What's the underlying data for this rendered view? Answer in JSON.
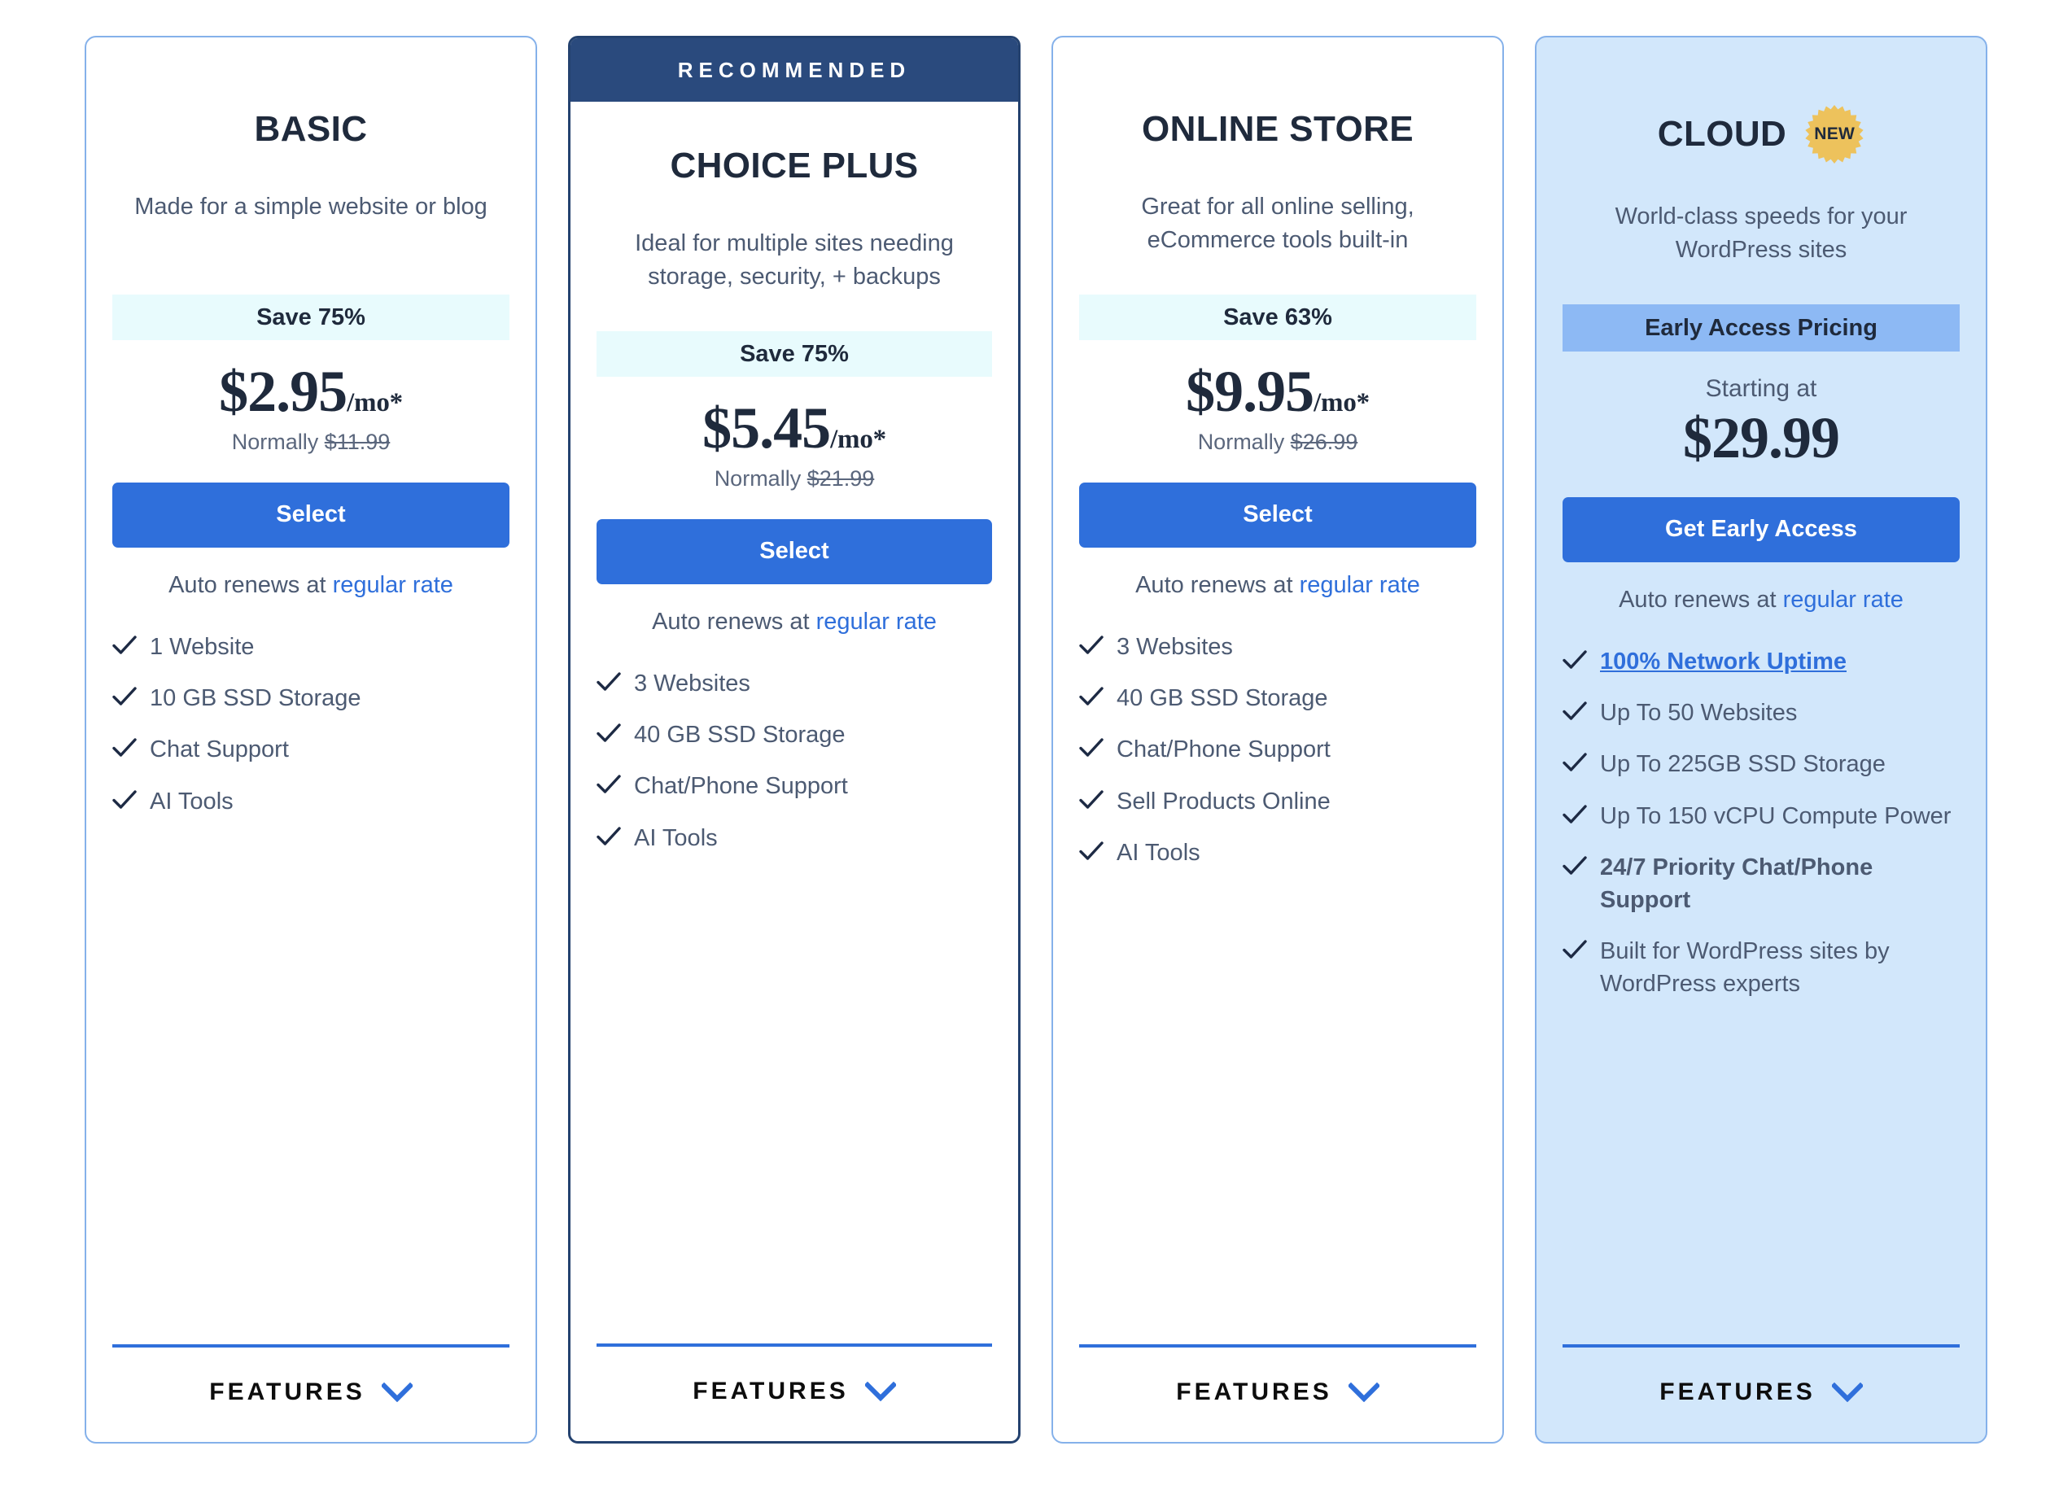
{
  "colors": {
    "accent_blue": "#2f6fdb",
    "navy": "#2a4a7d",
    "card_border": "#85b1ea",
    "save_banner_bg": "#e8fbfd",
    "cloud_card_bg": "#d2e7fb",
    "cloud_banner_bg": "#8db9f4",
    "badge_gold": "#edc25c",
    "text_dark": "#1f2a3c",
    "text_muted": "#4c5a72"
  },
  "footer": {
    "features_label": "FEATURES",
    "chevron_icon": "chevron-down-icon"
  },
  "plans": [
    {
      "id": "basic",
      "title": "BASIC",
      "ribbon": null,
      "badge": null,
      "tagline": "Made for a simple website or blog",
      "save_banner": "Save 75%",
      "starting_at": null,
      "price_main": "$2.95",
      "price_unit": "/mo*",
      "normally_prefix": "Normally ",
      "normally_price": "$11.99",
      "cta_label": "Select",
      "renew_prefix": "Auto renews at ",
      "renew_link": "regular rate",
      "features": [
        {
          "text": "1 Website",
          "style": "normal"
        },
        {
          "text": "10 GB SSD Storage",
          "style": "normal"
        },
        {
          "text": "Chat Support",
          "style": "normal"
        },
        {
          "text": "AI Tools",
          "style": "normal"
        }
      ]
    },
    {
      "id": "choice-plus",
      "title": "CHOICE PLUS",
      "ribbon": "RECOMMENDED",
      "badge": null,
      "tagline": "Ideal for multiple sites needing storage, security, + backups",
      "save_banner": "Save 75%",
      "starting_at": null,
      "price_main": "$5.45",
      "price_unit": "/mo*",
      "normally_prefix": "Normally ",
      "normally_price": "$21.99",
      "cta_label": "Select",
      "renew_prefix": "Auto renews at ",
      "renew_link": "regular rate",
      "features": [
        {
          "text": "3 Websites",
          "style": "normal"
        },
        {
          "text": "40 GB SSD Storage",
          "style": "normal"
        },
        {
          "text": "Chat/Phone Support",
          "style": "normal"
        },
        {
          "text": "AI Tools",
          "style": "normal"
        }
      ]
    },
    {
      "id": "online-store",
      "title": "ONLINE STORE",
      "ribbon": null,
      "badge": null,
      "tagline": "Great for all online selling, eCommerce tools built-in",
      "save_banner": "Save 63%",
      "starting_at": null,
      "price_main": "$9.95",
      "price_unit": "/mo*",
      "normally_prefix": "Normally ",
      "normally_price": "$26.99",
      "cta_label": "Select",
      "renew_prefix": "Auto renews at ",
      "renew_link": "regular rate",
      "features": [
        {
          "text": "3 Websites",
          "style": "normal"
        },
        {
          "text": "40 GB SSD Storage",
          "style": "normal"
        },
        {
          "text": "Chat/Phone Support",
          "style": "normal"
        },
        {
          "text": "Sell Products Online",
          "style": "normal"
        },
        {
          "text": "AI Tools",
          "style": "normal"
        }
      ]
    },
    {
      "id": "cloud",
      "title": "CLOUD",
      "ribbon": null,
      "badge": "NEW",
      "tagline": "World-class speeds for your WordPress sites",
      "save_banner": "Early Access Pricing",
      "starting_at": "Starting at",
      "price_main": "$29.99",
      "price_unit": "",
      "normally_prefix": "",
      "normally_price": "",
      "cta_label": "Get Early Access",
      "renew_prefix": "Auto renews at ",
      "renew_link": "regular rate",
      "features": [
        {
          "text": "100% Network Uptime",
          "style": "linked"
        },
        {
          "text": "Up To 50 Websites",
          "style": "normal"
        },
        {
          "text": "Up To 225GB SSD Storage",
          "style": "normal"
        },
        {
          "text": "Up To 150 vCPU Compute Power",
          "style": "normal"
        },
        {
          "text": "24/7 Priority Chat/Phone Support",
          "style": "bold"
        },
        {
          "text": "Built for WordPress sites by WordPress experts",
          "style": "normal"
        }
      ]
    }
  ]
}
